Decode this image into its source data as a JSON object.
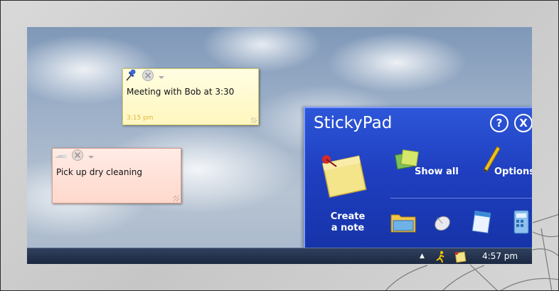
{
  "notes": [
    {
      "text": "Meeting with Bob at 3:30",
      "time": "3:15 pm",
      "color": "#fff7bf"
    },
    {
      "text": "Pick up dry cleaning",
      "color": "#ffd8cc"
    }
  ],
  "stickypad": {
    "title": "StickyPad",
    "help_label": "?",
    "close_label": "X",
    "create_label_line1": "Create",
    "create_label_line2": "a note",
    "show_all_label": "Show all",
    "options_label": "Options",
    "accent": "#1f3fc0"
  },
  "taskbar": {
    "clock": "4:57 pm",
    "tray_arrow": "▲"
  }
}
